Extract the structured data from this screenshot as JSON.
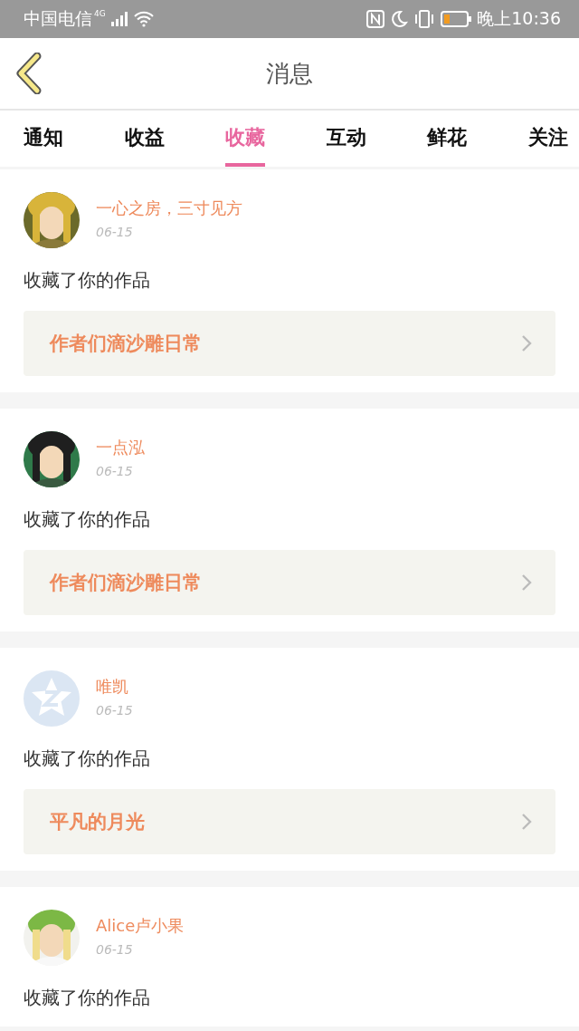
{
  "status_bar": {
    "carrier": "中国电信",
    "network": "4G",
    "time": "晚上10:36"
  },
  "header": {
    "title": "消息"
  },
  "tabs": [
    {
      "label": "通知",
      "selected": false
    },
    {
      "label": "收益",
      "selected": false
    },
    {
      "label": "收藏",
      "selected": true
    },
    {
      "label": "互动",
      "selected": false
    },
    {
      "label": "鲜花",
      "selected": false
    },
    {
      "label": "关注",
      "selected": false
    }
  ],
  "messages": [
    {
      "name": "一心之房，三寸见方",
      "date": "06-15",
      "action": "收藏了你的作品",
      "work": "作者们滴沙雕日常"
    },
    {
      "name": "一点泓",
      "date": "06-15",
      "action": "收藏了你的作品",
      "work": "作者们滴沙雕日常"
    },
    {
      "avatar": {
        "kind": "default"
      },
      "name": "唯凯",
      "date": "06-15",
      "action": "收藏了你的作品",
      "work": "平凡的月光"
    },
    {
      "name": "Alice卢小果",
      "date": "06-15",
      "action": "收藏了你的作品"
    }
  ]
}
